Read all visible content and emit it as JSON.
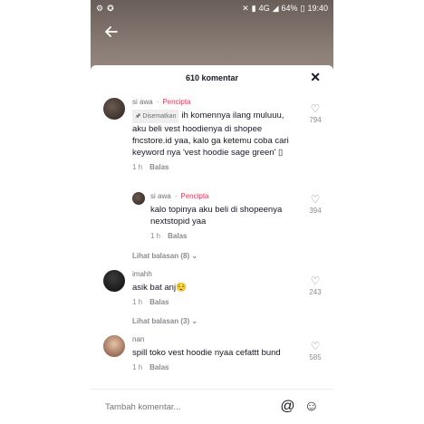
{
  "status_bar": {
    "left_icons": [
      "⚙",
      "✪"
    ],
    "network": "4G",
    "battery": "64%",
    "time": "19:40"
  },
  "header": {
    "back_icon": "arrow-left-icon",
    "title": "610 komentar",
    "close_icon": "close-icon"
  },
  "comments": [
    {
      "author": "si awa",
      "badge": "Pencipta",
      "pinned_label": "Disematkan",
      "text": "ih komennya ilang muluuu, aku beli vest hoodienya di shopee fncstore.id yaa, kalo ga ketemu coba cari keyword nya 'vest hoodie sage green' ▯",
      "time": "1 h",
      "reply_label": "Balas",
      "likes": "794"
    },
    {
      "author": "si awa",
      "badge": "Pencipta",
      "text": "kalo topinya aku beli di shopeenya nextstopid yaa",
      "time": "1 h",
      "reply_label": "Balas",
      "likes": "394"
    },
    {
      "author": "imahh",
      "text": "asik bat anj😌",
      "time": "1 h",
      "reply_label": "Balas",
      "likes": "243"
    },
    {
      "author": "nan",
      "text": "spill toko vest hoodie nyaa cefattt bund",
      "time": "1 h",
      "reply_label": "Balas",
      "likes": "585"
    }
  ],
  "view_replies": [
    "Lihat balasan (8)",
    "Lihat balasan (3)"
  ],
  "input": {
    "placeholder": "Tambah komentar...",
    "mention_icon": "@",
    "emoji_icon": "☺"
  },
  "colors": {
    "creator_red": "#fe2c55",
    "text_dark": "#161823",
    "text_gray": "#8a8b91"
  }
}
